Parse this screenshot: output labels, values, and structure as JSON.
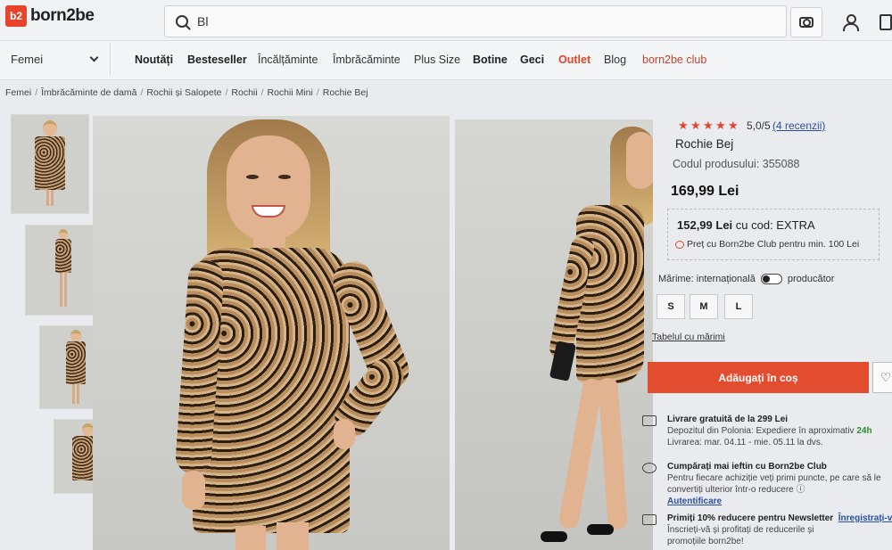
{
  "header": {
    "logo_badge": "b2",
    "logo_text": "born2be",
    "search_value": "Bl"
  },
  "nav": {
    "category_select": "Femei",
    "items": [
      "Noutăți",
      "Besteseller",
      "Încălțăminte",
      "Îmbrăcăminte",
      "Plus Size",
      "Botine",
      "Geci",
      "Outlet",
      "Blog",
      "born2be club"
    ]
  },
  "breadcrumb": [
    "Femei",
    "Îmbrăcăminte de damă",
    "Rochii și Salopete",
    "Rochii",
    "Rochii Mini",
    "Rochie Bej"
  ],
  "product": {
    "rating": "5,0/5",
    "reviews": "(4 recenzii)",
    "title": "Rochie Bej",
    "code": "Codul produsului: 355088",
    "price": "169,99 Lei",
    "promo_price": "152,99 Lei",
    "promo_code": "cu cod: EXTRA",
    "promo_note": "Preț cu Born2be Club pentru min. 100 Lei",
    "size_label": "Mărime: internațională",
    "size_label_alt": "producător",
    "sizes": [
      "S",
      "M",
      "L"
    ],
    "size_table": "Tabelul cu mărimi",
    "add_to_cart": "Adăugați în coș",
    "colors": {
      "accent": "#e34d2f",
      "star": "#e8442b",
      "link": "#2b4fa3"
    }
  },
  "info": {
    "delivery_title": "Livrare gratuită de la 299 Lei",
    "delivery_line1": "Depozitul din Polonia: Expediere în aproximativ",
    "delivery_highlight": "24h",
    "delivery_line2": "Livrarea: mar. 04.11 - mie. 05.11 la dvs.",
    "club_title": "Cumpărați mai ieftin cu Born2be Club",
    "club_line1": "Pentru fiecare achiziție veți primi puncte, pe care să le",
    "club_line2": "convertiți ulterior într-o reducere",
    "club_link": "Autentificare",
    "newsletter_title": "Primiți 10% reducere pentru Newsletter",
    "newsletter_link": "Înregistrați-vă",
    "newsletter_line1": "Înscrieți-vă și profitați de reducerile și",
    "newsletter_line2": "promoțiile born2be!"
  }
}
